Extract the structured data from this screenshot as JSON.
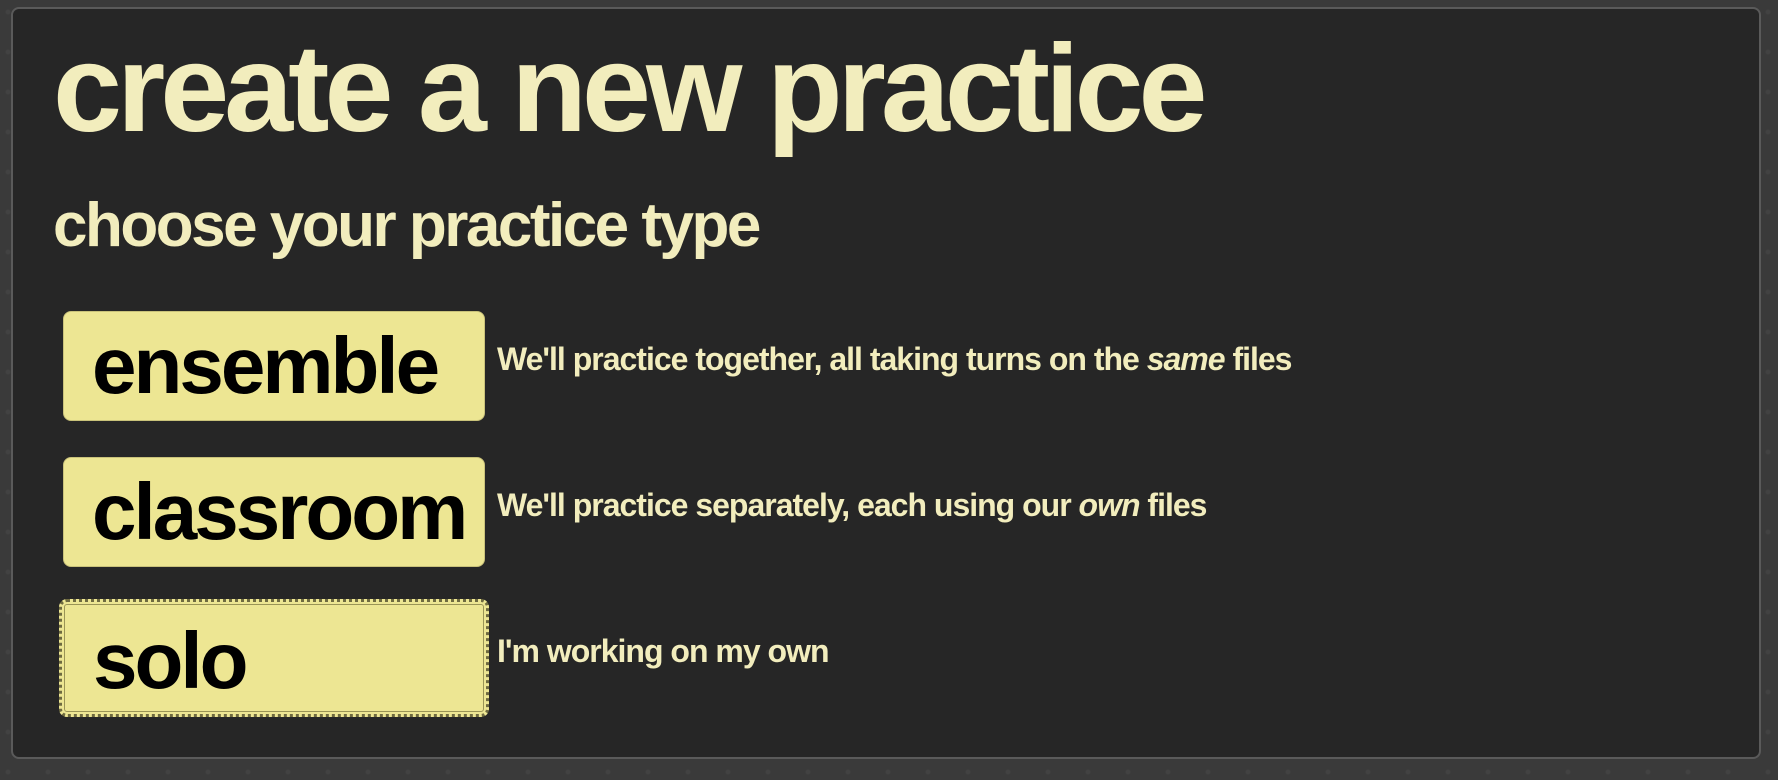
{
  "page": {
    "title": "create a new practice",
    "subtitle": "choose your practice type"
  },
  "options": [
    {
      "label": "ensemble",
      "desc_before": "We'll practice together, all taking turns on the ",
      "desc_em": "same",
      "desc_after": " files"
    },
    {
      "label": "classroom",
      "desc_before": "We'll practice separately, each using our ",
      "desc_em": "own",
      "desc_after": " files"
    },
    {
      "label": "solo",
      "desc_before": "I'm working on my own",
      "desc_em": "",
      "desc_after": ""
    }
  ],
  "colors": {
    "panel_bg": "#262626",
    "heading_text": "#f2edbd",
    "button_bg": "#ede693",
    "button_text": "#000000"
  }
}
